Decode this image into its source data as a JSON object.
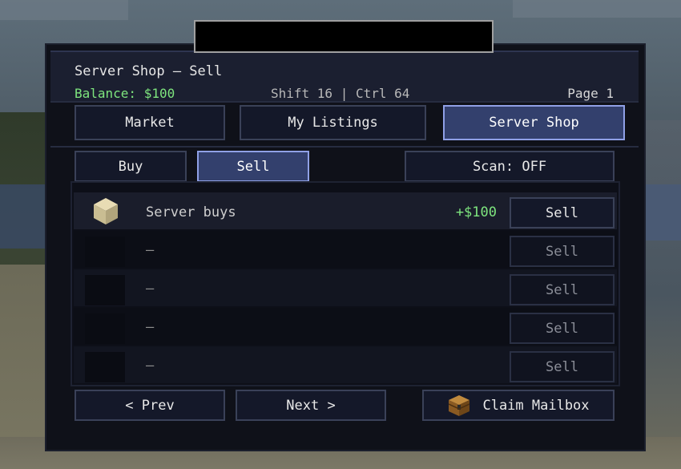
{
  "screen": {
    "title": "Server Shop — Sell",
    "balance": "Balance: $100",
    "modifier_hint": "Shift 16 | Ctrl 64",
    "page": "Page 1"
  },
  "tabs": [
    {
      "label": "Market",
      "active": false
    },
    {
      "label": "My Listings",
      "active": false
    },
    {
      "label": "Server Shop",
      "active": true
    }
  ],
  "mode_tabs": [
    {
      "label": "Buy",
      "active": false
    },
    {
      "label": "Sell",
      "active": true
    }
  ],
  "scan_toggle": "Scan: OFF",
  "rows": [
    {
      "item_icon": "sandstone-block-icon",
      "name": "Server buys",
      "price": "+$100",
      "action": "Sell",
      "enabled": true
    },
    {
      "item_icon": "",
      "name": "—",
      "price": "",
      "action": "Sell",
      "enabled": false
    },
    {
      "item_icon": "",
      "name": "—",
      "price": "",
      "action": "Sell",
      "enabled": false
    },
    {
      "item_icon": "",
      "name": "—",
      "price": "",
      "action": "Sell",
      "enabled": false
    },
    {
      "item_icon": "",
      "name": "—",
      "price": "",
      "action": "Sell",
      "enabled": false
    }
  ],
  "footer": {
    "prev": "< Prev",
    "next": "Next >",
    "claim_mailbox": "Claim Mailbox",
    "claim_icon": "chest-icon"
  },
  "colors": {
    "accent_active": "#33406d",
    "price_positive": "#7ee57e",
    "panel_bg": "#0f1119"
  }
}
